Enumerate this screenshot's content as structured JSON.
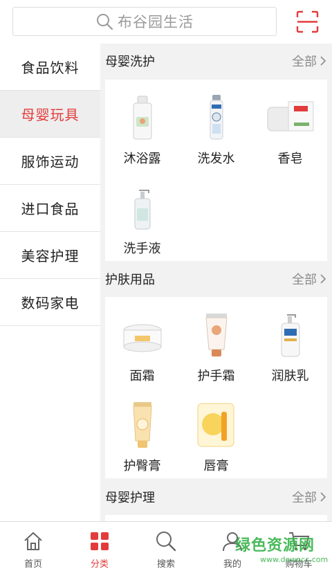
{
  "search": {
    "placeholder_text": "布谷园生活"
  },
  "sidebar": {
    "items": [
      {
        "label": "食品饮料"
      },
      {
        "label": "母婴玩具",
        "active": true
      },
      {
        "label": "服饰运动"
      },
      {
        "label": "进口食品"
      },
      {
        "label": "美容护理"
      },
      {
        "label": "数码家电"
      }
    ]
  },
  "sections": [
    {
      "title": "母婴洗护",
      "more": "全部",
      "items": [
        {
          "label": "沐浴露",
          "icon": "bath-lotion-bottle-icon"
        },
        {
          "label": "洗发水",
          "icon": "shampoo-bottle-icon"
        },
        {
          "label": "香皂",
          "icon": "soap-bar-icon"
        },
        {
          "label": "洗手液",
          "icon": "hand-soap-pump-icon"
        }
      ]
    },
    {
      "title": "护肤用品",
      "more": "全部",
      "items": [
        {
          "label": "面霜",
          "icon": "face-cream-jar-icon"
        },
        {
          "label": "护手霜",
          "icon": "hand-cream-tube-icon"
        },
        {
          "label": "润肤乳",
          "icon": "lotion-pump-bottle-icon"
        },
        {
          "label": "护臀膏",
          "icon": "diaper-cream-tube-icon"
        },
        {
          "label": "唇膏",
          "icon": "lip-balm-icon"
        }
      ]
    },
    {
      "title": "母婴护理",
      "more": "全部",
      "items": []
    }
  ],
  "tabbar": {
    "items": [
      {
        "label": "首页",
        "icon": "home-icon"
      },
      {
        "label": "分类",
        "icon": "category-grid-icon",
        "active": true
      },
      {
        "label": "搜索",
        "icon": "search-icon"
      },
      {
        "label": "我的",
        "icon": "user-icon"
      },
      {
        "label": "购物车",
        "icon": "cart-icon"
      }
    ]
  },
  "watermark": {
    "main": "绿色资源网",
    "sub": "www.downcc.com"
  },
  "colors": {
    "accent": "#e33b3b",
    "sidebar_active_bg": "#eeeeee",
    "content_bg": "#f2f2f2"
  }
}
